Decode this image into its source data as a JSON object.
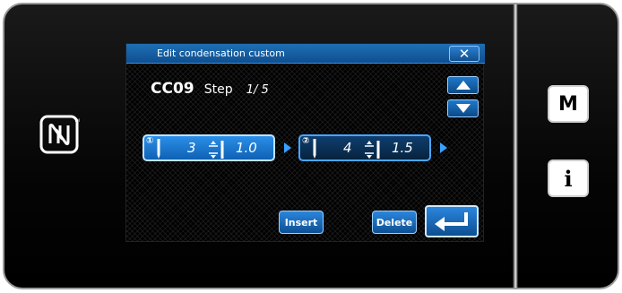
{
  "dialog": {
    "title": "Edit condensation custom",
    "close_symbol": "✕"
  },
  "pattern": {
    "code": "CC09",
    "step_label": "Step",
    "step_position": "1/ 5"
  },
  "stitches": [
    {
      "index": "①",
      "count": "3",
      "length": "1.0",
      "selected": true
    },
    {
      "index": "②",
      "count": "4",
      "length": "1.5",
      "selected": false
    }
  ],
  "buttons": {
    "insert": "Insert",
    "delete": "Delete"
  },
  "side_buttons": {
    "mode": "M",
    "info": "i"
  },
  "icons": {
    "nfc": "nfc-icon",
    "needle": "needle-icon",
    "pitch": "stitch-pitch-icon",
    "enter": "enter-icon",
    "up": "up-arrow-icon",
    "down": "down-arrow-icon"
  },
  "colors": {
    "accent": "#1a7bd6",
    "selected_fill": "#2b8fe8",
    "panel_bg": "#000000"
  }
}
